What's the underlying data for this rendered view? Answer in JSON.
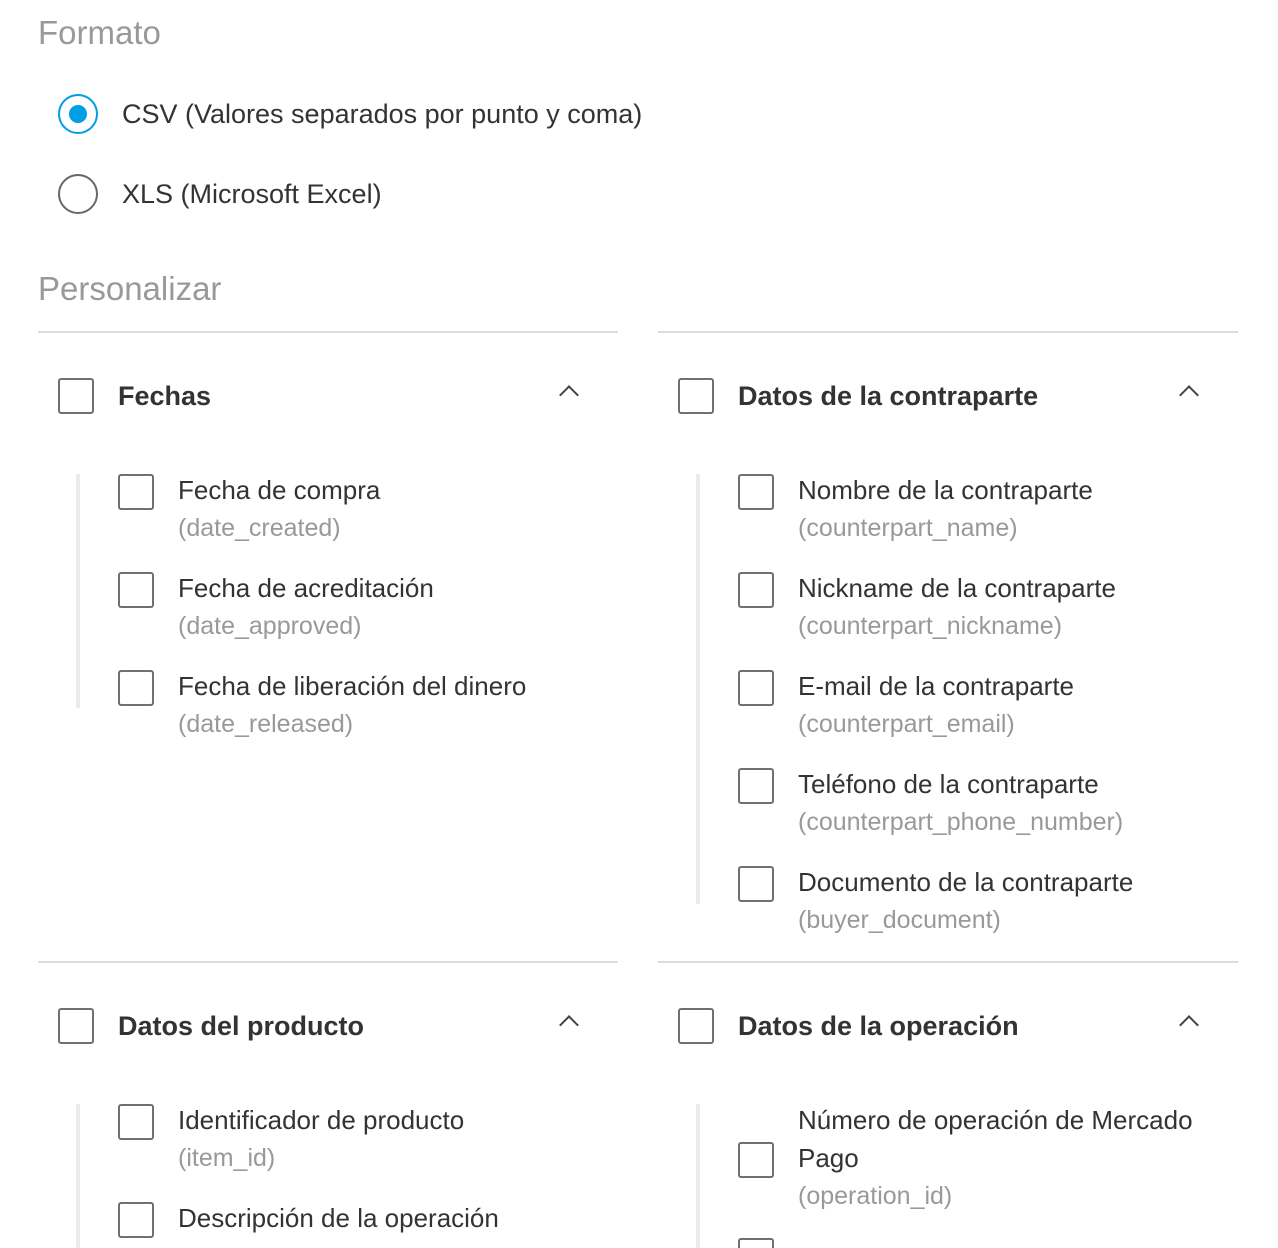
{
  "formato": {
    "title": "Formato",
    "options": [
      {
        "label": "CSV (Valores separados por punto y coma)",
        "selected": true
      },
      {
        "label": "XLS (Microsoft Excel)",
        "selected": false
      }
    ]
  },
  "personalizar": {
    "title": "Personalizar"
  },
  "groups": {
    "fechas": {
      "title": "Fechas",
      "items": [
        {
          "label": "Fecha de compra",
          "code": "(date_created)"
        },
        {
          "label": "Fecha de acreditación",
          "code": "(date_approved)"
        },
        {
          "label": "Fecha de liberación del dinero",
          "code": "(date_released)"
        }
      ]
    },
    "contraparte": {
      "title": "Datos de la contraparte",
      "items": [
        {
          "label": "Nombre de la contraparte",
          "code": "(counterpart_name)"
        },
        {
          "label": "Nickname de la contraparte",
          "code": "(counterpart_nickname)"
        },
        {
          "label": "E-mail de la contraparte",
          "code": "(counterpart_email)"
        },
        {
          "label": "Teléfono de la contraparte",
          "code": "(counterpart_phone_number)"
        },
        {
          "label": "Documento de la contraparte",
          "code": "(buyer_document)"
        }
      ]
    },
    "producto": {
      "title": "Datos del producto",
      "items": [
        {
          "label": "Identificador de producto",
          "code": "(item_id)"
        },
        {
          "label": "Descripción de la operación",
          "code": ""
        }
      ]
    },
    "operacion": {
      "title": "Datos de la operación",
      "items": [
        {
          "label": "Número de operación de Mercado Pago",
          "code": "(operation_id)"
        }
      ]
    }
  },
  "colors": {
    "accent": "#009ee3",
    "muted_text": "#999999",
    "text": "#333333",
    "divider": "#dcdcdc"
  },
  "icons": {
    "group_toggle": "chevron-up-icon"
  }
}
